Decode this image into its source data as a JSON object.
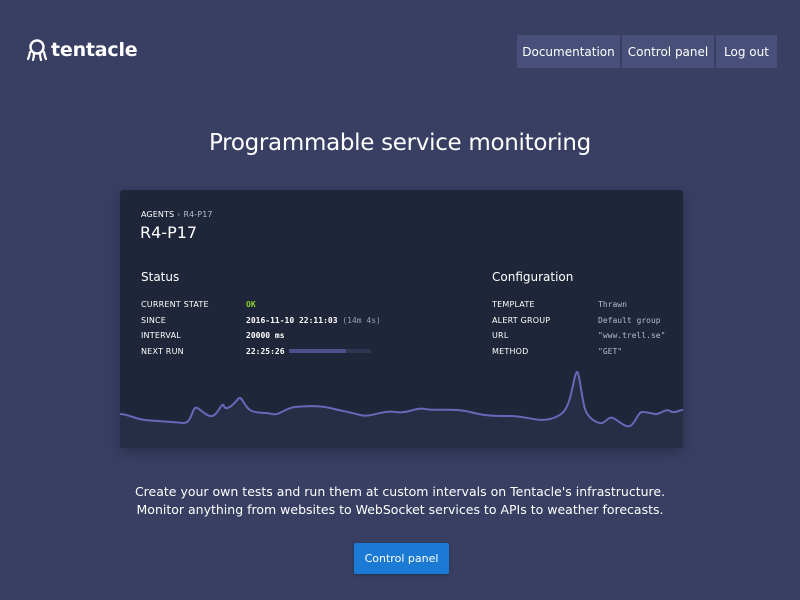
{
  "brand": {
    "name": "tentacle",
    "icon": "tentacle-logo-icon"
  },
  "nav": {
    "items": [
      {
        "label": "Documentation"
      },
      {
        "label": "Control panel"
      },
      {
        "label": "Log out"
      }
    ]
  },
  "hero": {
    "headline": "Programmable service monitoring",
    "subtext_line1": "Create your own tests and run them at custom intervals on Tentacle's infrastructure.",
    "subtext_line2": "Monitor anything from websites to WebSocket services to APIs to weather forecasts.",
    "cta_label": "Control panel"
  },
  "card": {
    "breadcrumb": {
      "parent": "AGENTS",
      "separator": "›",
      "current": "R4-P17"
    },
    "title": "R4-P17",
    "status": {
      "title": "Status",
      "current_state_label": "CURRENT STATE",
      "current_state_value": "OK",
      "since_label": "SINCE",
      "since_value": "2016-11-10 22:11:03",
      "since_duration": "(14m 4s)",
      "interval_label": "INTERVAL",
      "interval_value": "20000 ms",
      "next_run_label": "NEXT RUN",
      "next_run_value": "22:25:26",
      "next_run_progress": 0.7
    },
    "configuration": {
      "title": "Configuration",
      "template_label": "TEMPLATE",
      "template_value": "Thrawn",
      "alert_group_label": "ALERT GROUP",
      "alert_group_value": "Default group",
      "url_label": "URL",
      "url_value": "\"www.trell.se\"",
      "method_label": "METHOD",
      "method_value": "\"GET\""
    }
  },
  "colors": {
    "background": "#383f63",
    "nav_button": "#48507a",
    "card": "#1f2639",
    "ok": "#8fd22a",
    "graph_line": "#6a66b8",
    "cta": "#1a7ad4"
  }
}
